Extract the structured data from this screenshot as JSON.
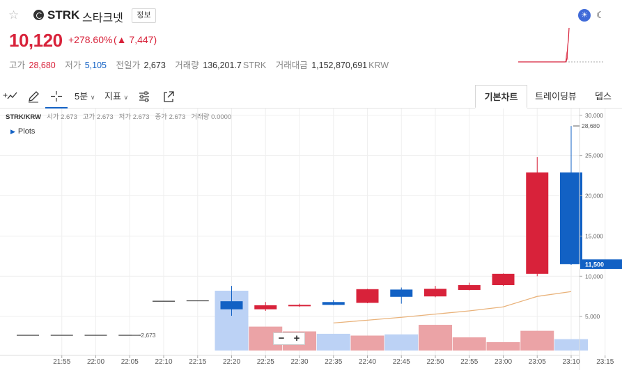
{
  "header": {
    "symbol": "STRK",
    "name": "스타크넷",
    "info_label": "정보",
    "price": "10,120",
    "change_rate": "+278.60%",
    "change_arrow": "▲",
    "change_value": "7,447",
    "stats": {
      "high_label": "고가",
      "high": "28,680",
      "low_label": "저가",
      "low": "5,105",
      "prev_label": "전일가",
      "prev": "2,673",
      "volume_label": "거래량",
      "volume": "136,201.7",
      "volume_unit": "STRK",
      "amount_label": "거래대금",
      "amount": "1,152,870,691",
      "amount_unit": "KRW"
    },
    "theme_sun": "☀",
    "theme_moon": "☾"
  },
  "toolbar": {
    "interval": "5분",
    "interval_caret": "∨",
    "indicators": "지표",
    "indicators_caret": "∨",
    "tabs": [
      "기본차트",
      "트레이딩뷰",
      "뎁스"
    ]
  },
  "legend": {
    "pair": "STRK/KRW",
    "open_label": "시가",
    "open": "2.673",
    "high_label": "고가",
    "high": "2.673",
    "low_label": "저가",
    "low": "2.673",
    "close_label": "종가",
    "close": "2.673",
    "volume_label": "거래량",
    "volume": "0.0000"
  },
  "plots_label": "Plots",
  "zoom": {
    "minus": "−",
    "plus": "+"
  },
  "chart_data": {
    "type": "candlestick",
    "x_labels": [
      "21:55",
      "22:00",
      "22:05",
      "22:10",
      "22:15",
      "22:20",
      "22:25",
      "22:30",
      "22:35",
      "22:40",
      "22:45",
      "22:50",
      "22:55",
      "23:00",
      "23:05",
      "23:10",
      "23:15"
    ],
    "y_ticks": [
      5000,
      10000,
      15000,
      20000,
      25000,
      30000
    ],
    "y_tick_labels": [
      "5,000",
      "10,000",
      "15,000",
      "20,000",
      "25,000",
      "30,000"
    ],
    "ylim": [
      0,
      30500
    ],
    "current_price": 11500,
    "current_price_label": "11,500",
    "high_marker": 28680,
    "high_marker_label": "28,680",
    "low_marker_label": "2,673",
    "up_color": "#d8223a",
    "down_color": "#1261c4",
    "candles": [
      {
        "t": "21:50",
        "o": 2673,
        "h": 2673,
        "l": 2673,
        "c": 2673
      },
      {
        "t": "21:55",
        "o": 2673,
        "h": 2673,
        "l": 2673,
        "c": 2673
      },
      {
        "t": "22:00",
        "o": 2673,
        "h": 2673,
        "l": 2673,
        "c": 2673
      },
      {
        "t": "22:05",
        "o": 2673,
        "h": 2673,
        "l": 2673,
        "c": 2673
      },
      {
        "t": "22:10",
        "o": 6900,
        "h": 6900,
        "l": 6900,
        "c": 6900
      },
      {
        "t": "22:15",
        "o": 6950,
        "h": 6950,
        "l": 6950,
        "c": 6950
      },
      {
        "t": "22:20",
        "o": 6900,
        "h": 8800,
        "l": 5100,
        "c": 5900
      },
      {
        "t": "22:25",
        "o": 5900,
        "h": 6800,
        "l": 5700,
        "c": 6400
      },
      {
        "t": "22:30",
        "o": 6400,
        "h": 6600,
        "l": 6200,
        "c": 6450
      },
      {
        "t": "22:35",
        "o": 6800,
        "h": 7050,
        "l": 6400,
        "c": 6450
      },
      {
        "t": "22:40",
        "o": 6700,
        "h": 8450,
        "l": 6650,
        "c": 8400
      },
      {
        "t": "22:45",
        "o": 8350,
        "h": 8600,
        "l": 6600,
        "c": 7450
      },
      {
        "t": "22:50",
        "o": 7500,
        "h": 8800,
        "l": 7400,
        "c": 8450
      },
      {
        "t": "22:55",
        "o": 8300,
        "h": 9200,
        "l": 8250,
        "c": 8900
      },
      {
        "t": "23:00",
        "o": 8900,
        "h": 10350,
        "l": 8800,
        "c": 10300
      },
      {
        "t": "23:05",
        "o": 10300,
        "h": 24800,
        "l": 10000,
        "c": 22900
      },
      {
        "t": "23:10",
        "o": 22900,
        "h": 28680,
        "l": 11400,
        "c": 11500
      }
    ],
    "ma": [
      {
        "t": "22:35",
        "v": 4200
      },
      {
        "t": "22:40",
        "v": 4550
      },
      {
        "t": "22:45",
        "v": 4900
      },
      {
        "t": "22:50",
        "v": 5300
      },
      {
        "t": "22:55",
        "v": 5700
      },
      {
        "t": "23:00",
        "v": 6200
      },
      {
        "t": "23:05",
        "v": 7500
      },
      {
        "t": "23:10",
        "v": 8100
      }
    ],
    "volume": [
      {
        "t": "22:20",
        "v": 100,
        "dir": "down"
      },
      {
        "t": "22:25",
        "v": 40,
        "dir": "up"
      },
      {
        "t": "22:30",
        "v": 32,
        "dir": "up"
      },
      {
        "t": "22:35",
        "v": 28,
        "dir": "down"
      },
      {
        "t": "22:40",
        "v": 25,
        "dir": "up"
      },
      {
        "t": "22:45",
        "v": 27,
        "dir": "down"
      },
      {
        "t": "22:50",
        "v": 43,
        "dir": "up"
      },
      {
        "t": "22:55",
        "v": 22,
        "dir": "up"
      },
      {
        "t": "23:00",
        "v": 14,
        "dir": "up"
      },
      {
        "t": "23:05",
        "v": 33,
        "dir": "up"
      },
      {
        "t": "23:10",
        "v": 19,
        "dir": "down"
      }
    ]
  }
}
